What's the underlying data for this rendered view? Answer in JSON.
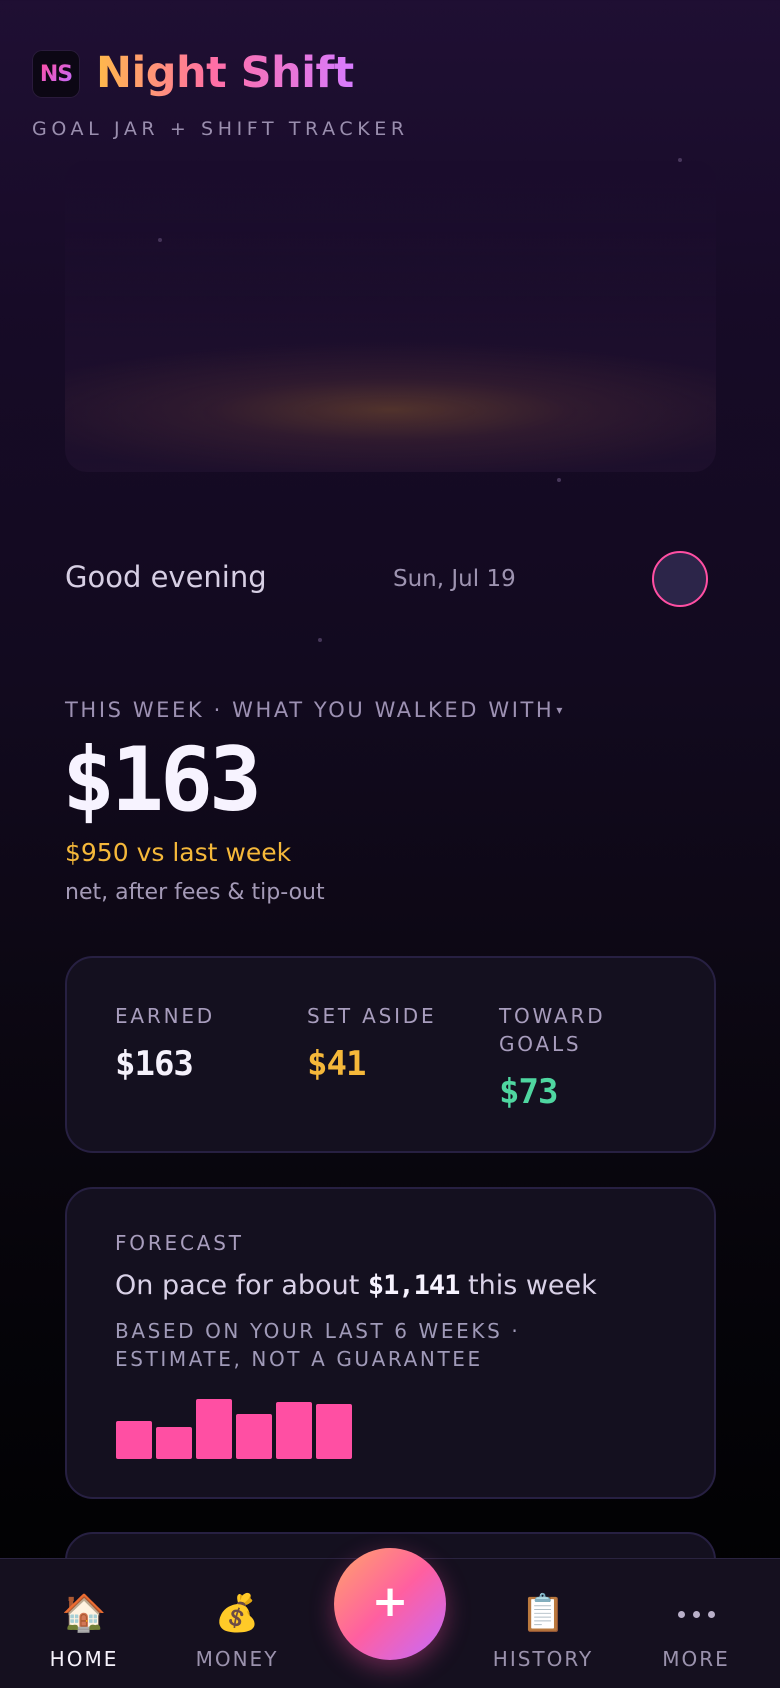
{
  "app": {
    "logo_text": "NS",
    "title": "Night Shift",
    "subtitle": "GOAL JAR + SHIFT TRACKER"
  },
  "greeting": {
    "text": "Good evening",
    "date": "Sun, Jul 19"
  },
  "week": {
    "label": "THIS WEEK · WHAT YOU WALKED WITH",
    "caret": "▾",
    "amount": "$163",
    "compare": "$950 vs last week",
    "note": "net, after fees & tip-out"
  },
  "stats": {
    "earned_label": "EARNED",
    "earned_value": "$163",
    "aside_label": "SET ASIDE",
    "aside_value": "$41",
    "goals_label": "TOWARD GOALS",
    "goals_value": "$73"
  },
  "forecast": {
    "label": "FORECAST",
    "prefix": "On pace for about ",
    "amount": "$1,141",
    "suffix": " this week",
    "basis": "BASED ON YOUR LAST 6 WEEKS · ESTIMATE, NOT A GUARANTEE",
    "weekly_bars": [
      0.58,
      0.49,
      0.92,
      0.69,
      0.87,
      0.84
    ]
  },
  "nav": {
    "home": "HOME",
    "money": "MONEY",
    "add": "+",
    "history": "HISTORY",
    "more": "MORE"
  },
  "colors": {
    "accent_pink": "#ff4fa3",
    "accent_gold": "#f5b83a",
    "accent_green": "#4fd6a0"
  }
}
